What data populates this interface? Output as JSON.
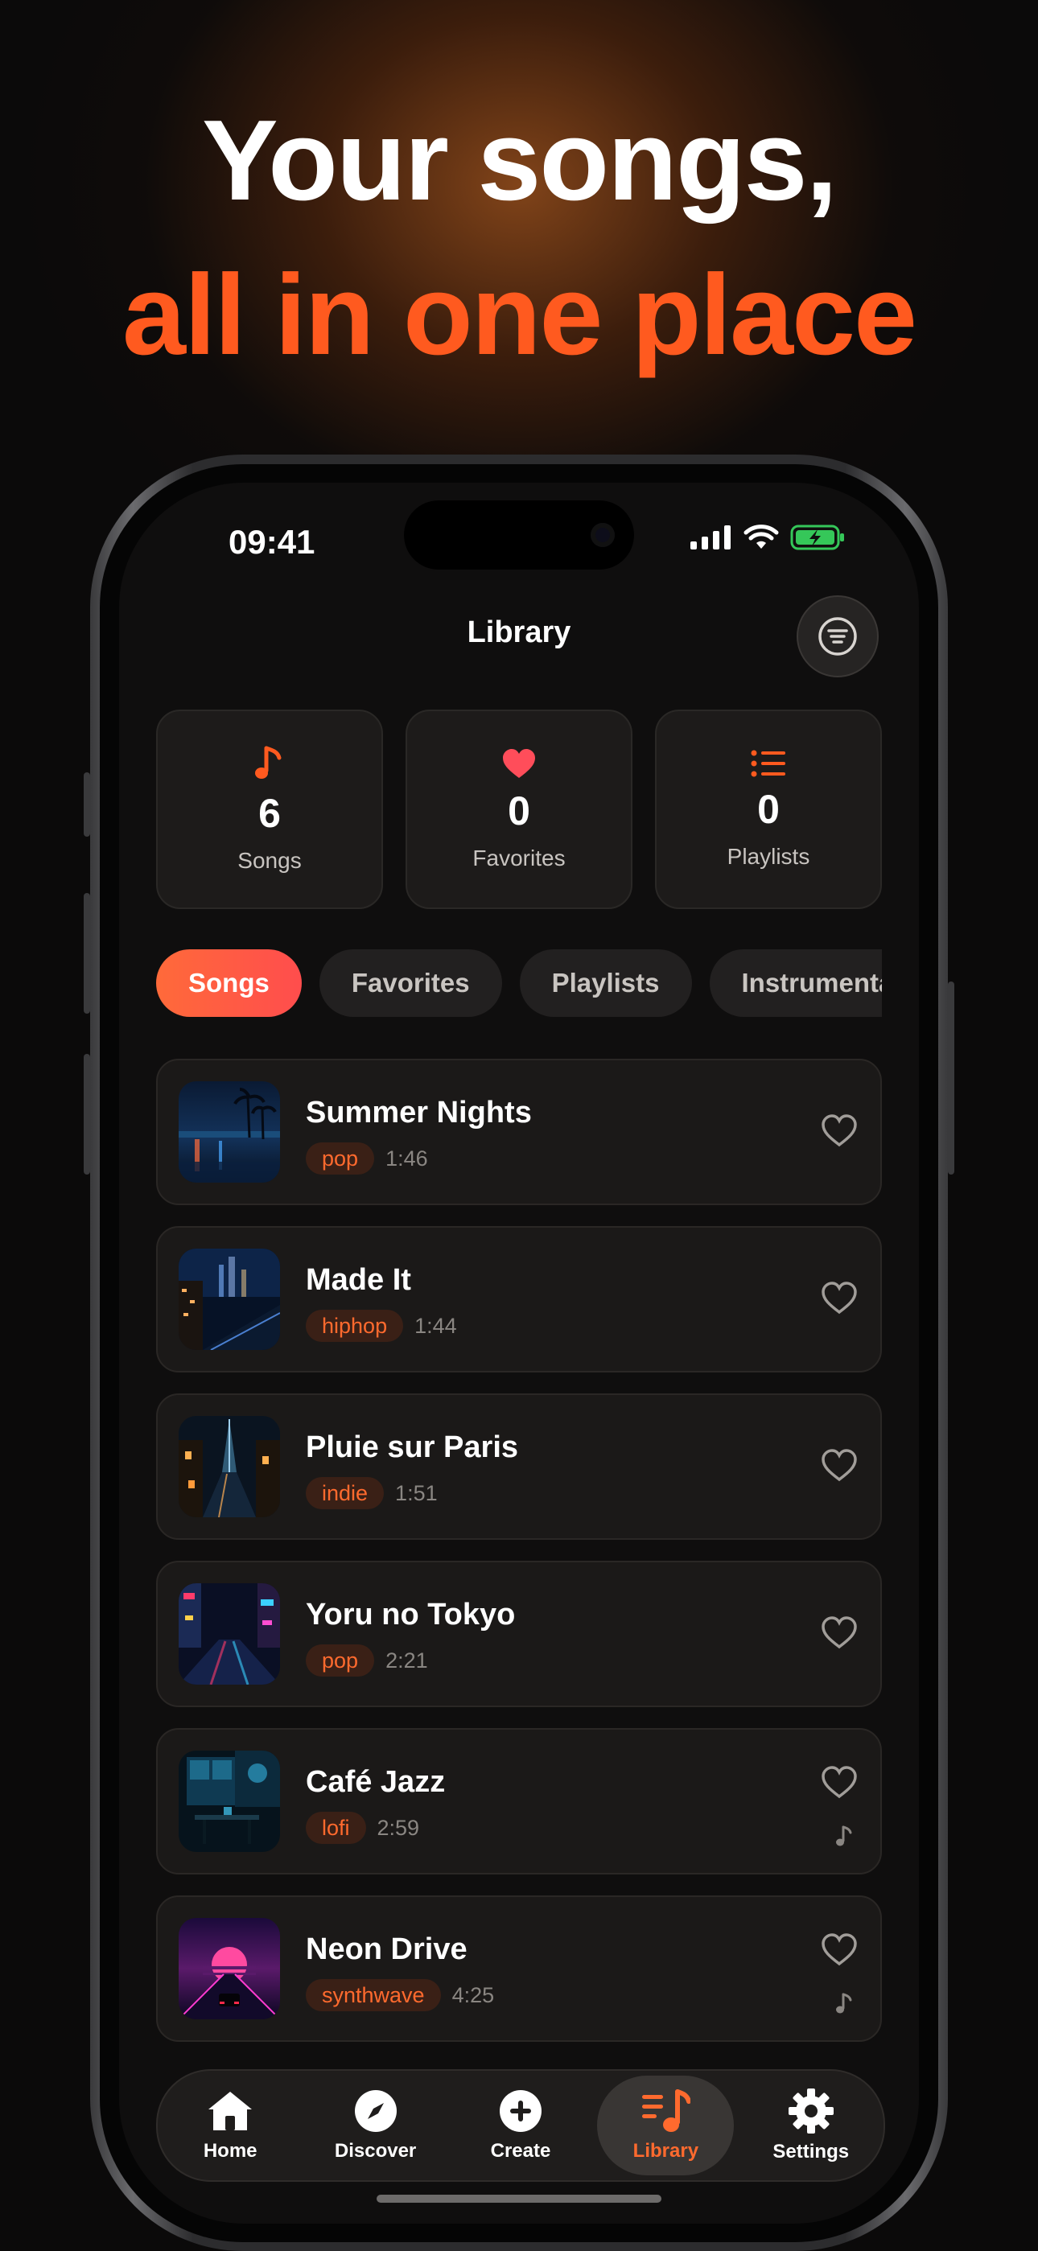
{
  "headline": {
    "line1": "Your songs,",
    "line2": "all in one place"
  },
  "status": {
    "time": "09:41"
  },
  "nav": {
    "title": "Library"
  },
  "stats": [
    {
      "icon": "music-note-icon",
      "value": "6",
      "label": "Songs"
    },
    {
      "icon": "heart-icon",
      "value": "0",
      "label": "Favorites"
    },
    {
      "icon": "list-icon",
      "value": "0",
      "label": "Playlists"
    }
  ],
  "tabs": [
    {
      "label": "Songs",
      "active": true
    },
    {
      "label": "Favorites"
    },
    {
      "label": "Playlists"
    },
    {
      "label": "Instrumental"
    }
  ],
  "songs": [
    {
      "title": "Summer Nights",
      "genre": "pop",
      "duration": "1:46"
    },
    {
      "title": "Made It",
      "genre": "hiphop",
      "duration": "1:44"
    },
    {
      "title": "Pluie sur Paris",
      "genre": "indie",
      "duration": "1:51"
    },
    {
      "title": "Yoru no Tokyo",
      "genre": "pop",
      "duration": "2:21"
    },
    {
      "title": "Café Jazz",
      "genre": "lofi",
      "duration": "2:59",
      "instrumental": true
    },
    {
      "title": "Neon Drive",
      "genre": "synthwave",
      "duration": "4:25",
      "instrumental": true
    }
  ],
  "tabbar": [
    {
      "label": "Home",
      "icon": "home-icon"
    },
    {
      "label": "Discover",
      "icon": "compass-icon"
    },
    {
      "label": "Create",
      "icon": "plus-circle-icon"
    },
    {
      "label": "Library",
      "icon": "library-icon",
      "active": true
    },
    {
      "label": "Settings",
      "icon": "gear-icon"
    }
  ],
  "colors": {
    "accent": "#ff5a1f",
    "tag_bg": "#3a2016",
    "background": "#0f0e0e"
  }
}
